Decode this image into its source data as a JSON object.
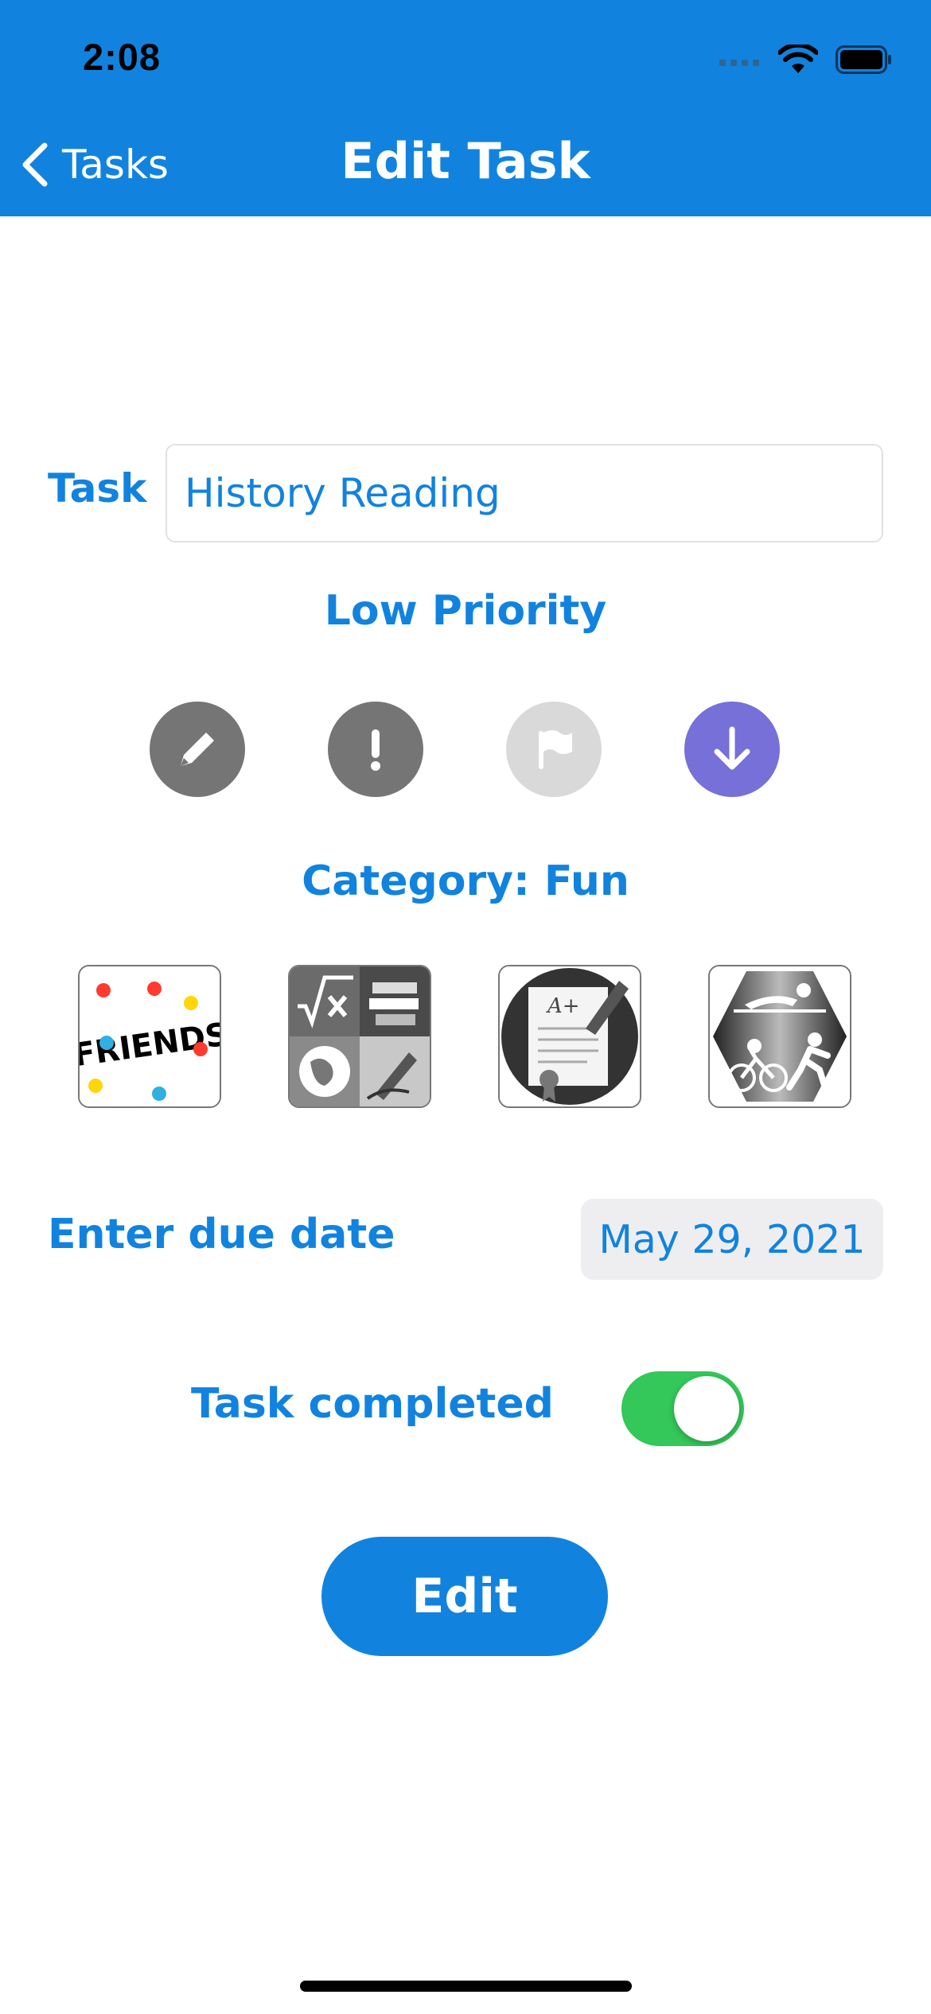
{
  "status_bar": {
    "time": "2:08"
  },
  "nav": {
    "back_label": "Tasks",
    "title": "Edit Task"
  },
  "form": {
    "task_label": "Task",
    "task_value": "History Reading",
    "priority_label": "Low Priority",
    "priority_options": [
      "pencil-icon",
      "exclamation-icon",
      "flag-icon",
      "arrow-down-icon"
    ],
    "priority_selected": "arrow-down-icon",
    "category_label": "Category: Fun",
    "categories": [
      "friends-tile",
      "math-study-tile",
      "grade-paper-tile",
      "triathlon-tile"
    ],
    "friends_logo_text": "FRIENDS",
    "grade_text": "A+",
    "due_label": "Enter due date",
    "due_date": "May 29, 2021",
    "completed_label": "Task completed",
    "completed": true,
    "edit_button": "Edit"
  },
  "colors": {
    "accent": "#1183DF",
    "toggle_on": "#34C759",
    "priority_selected": "#7670D8",
    "priority_gray": "#757575",
    "priority_light": "#D9D9D9"
  }
}
